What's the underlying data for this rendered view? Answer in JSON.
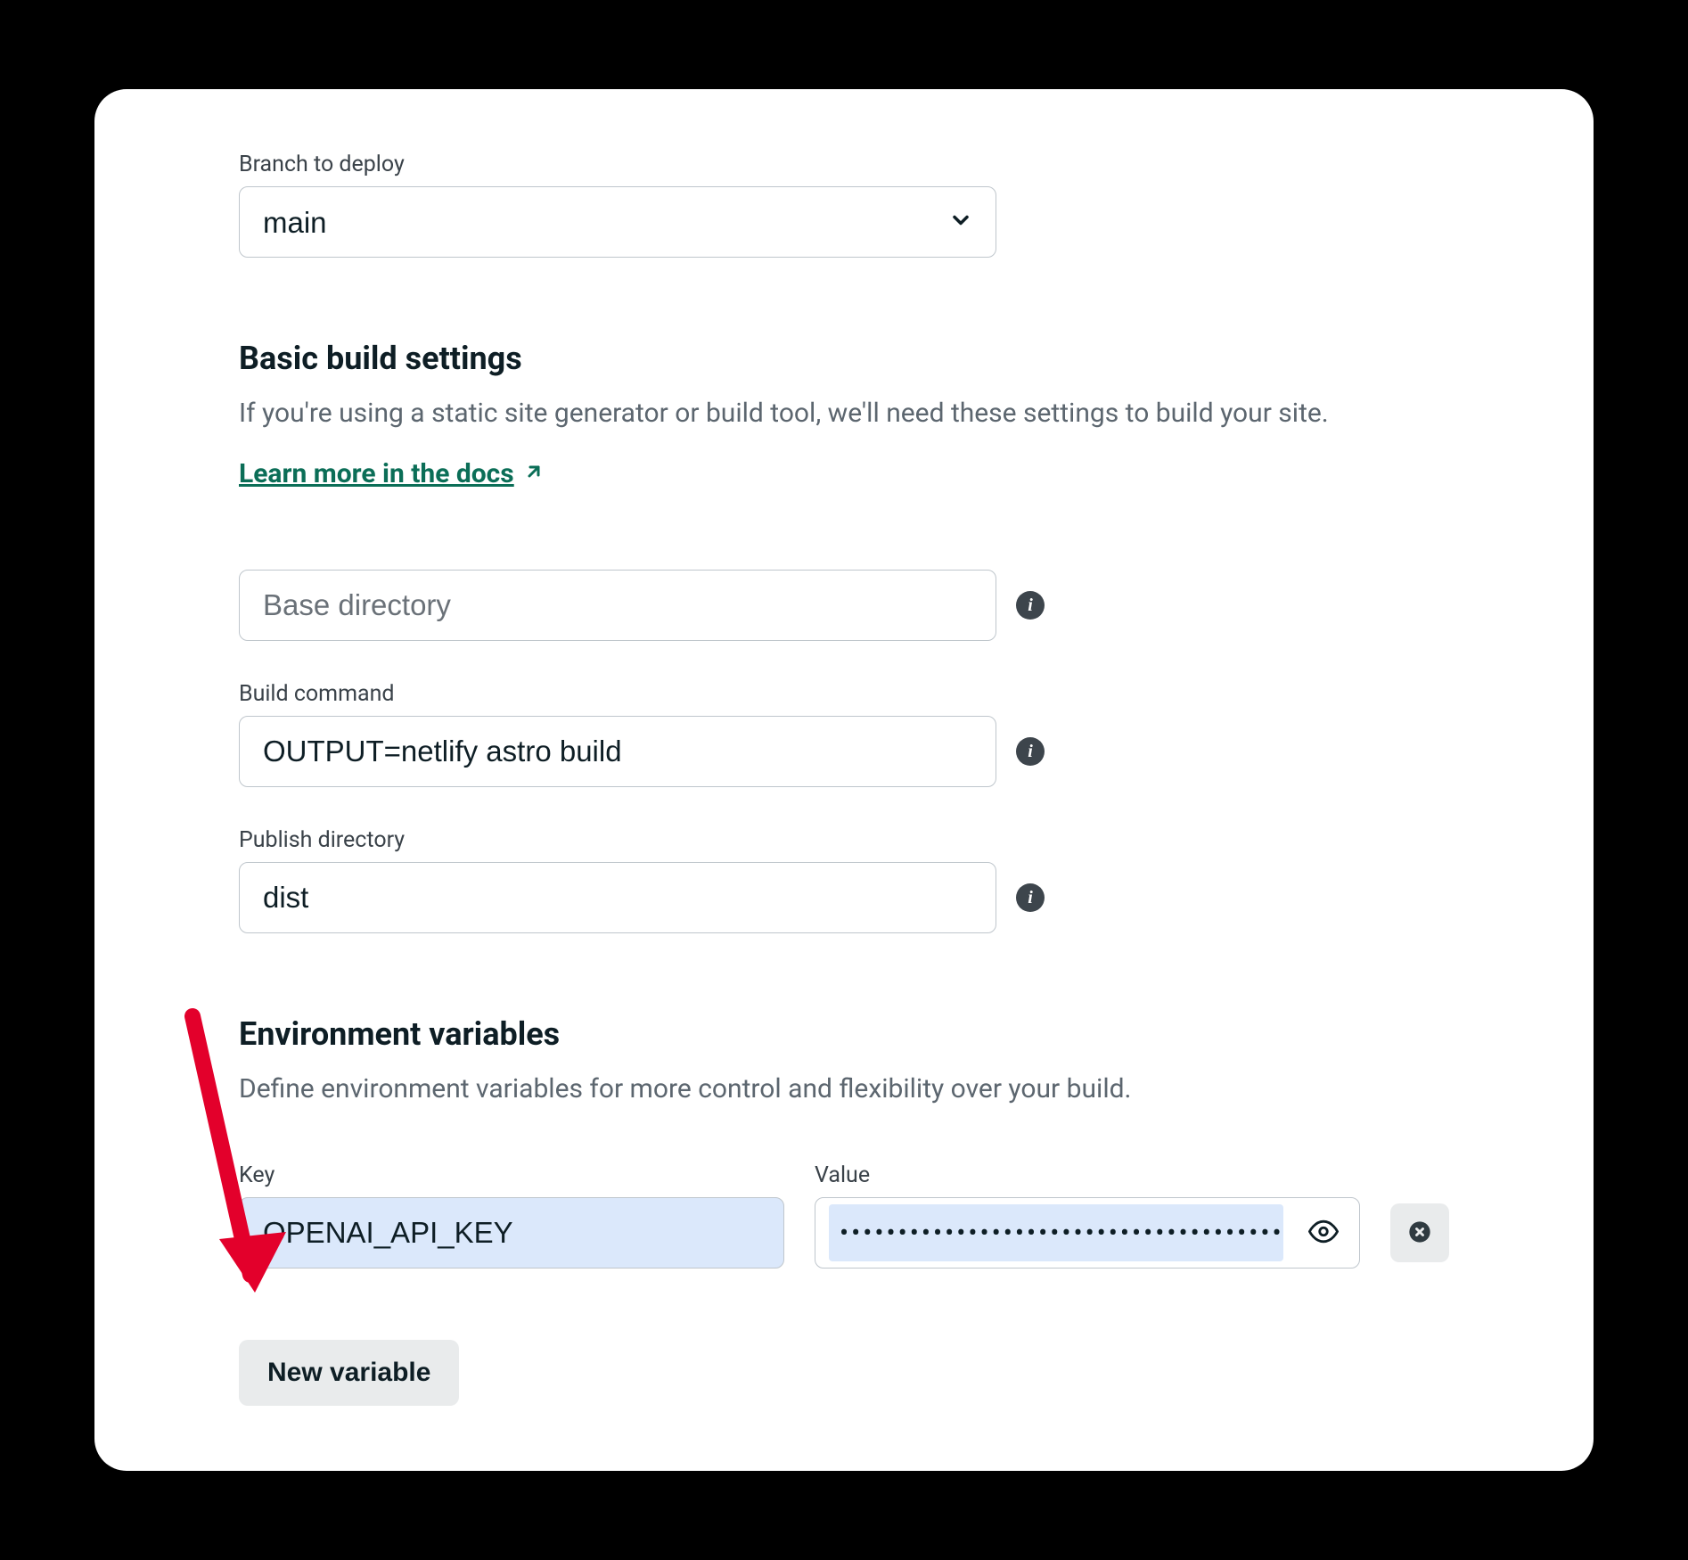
{
  "branch": {
    "label": "Branch to deploy",
    "value": "main"
  },
  "build": {
    "heading": "Basic build settings",
    "description": "If you're using a static site generator or build tool, we'll need these settings to build your site.",
    "docs_link": "Learn more in the docs",
    "base_dir": {
      "placeholder": "Base directory",
      "value": ""
    },
    "command": {
      "label": "Build command",
      "value": "OUTPUT=netlify astro build"
    },
    "publish_dir": {
      "label": "Publish directory",
      "value": "dist"
    }
  },
  "env": {
    "heading": "Environment variables",
    "description": "Define environment variables for more control and flexibility over your build.",
    "key_label": "Key",
    "value_label": "Value",
    "rows": [
      {
        "key": "OPENAI_API_KEY",
        "value_masked": "••••••••••••••••••••••••••••••••••••••"
      }
    ],
    "new_button": "New variable"
  }
}
